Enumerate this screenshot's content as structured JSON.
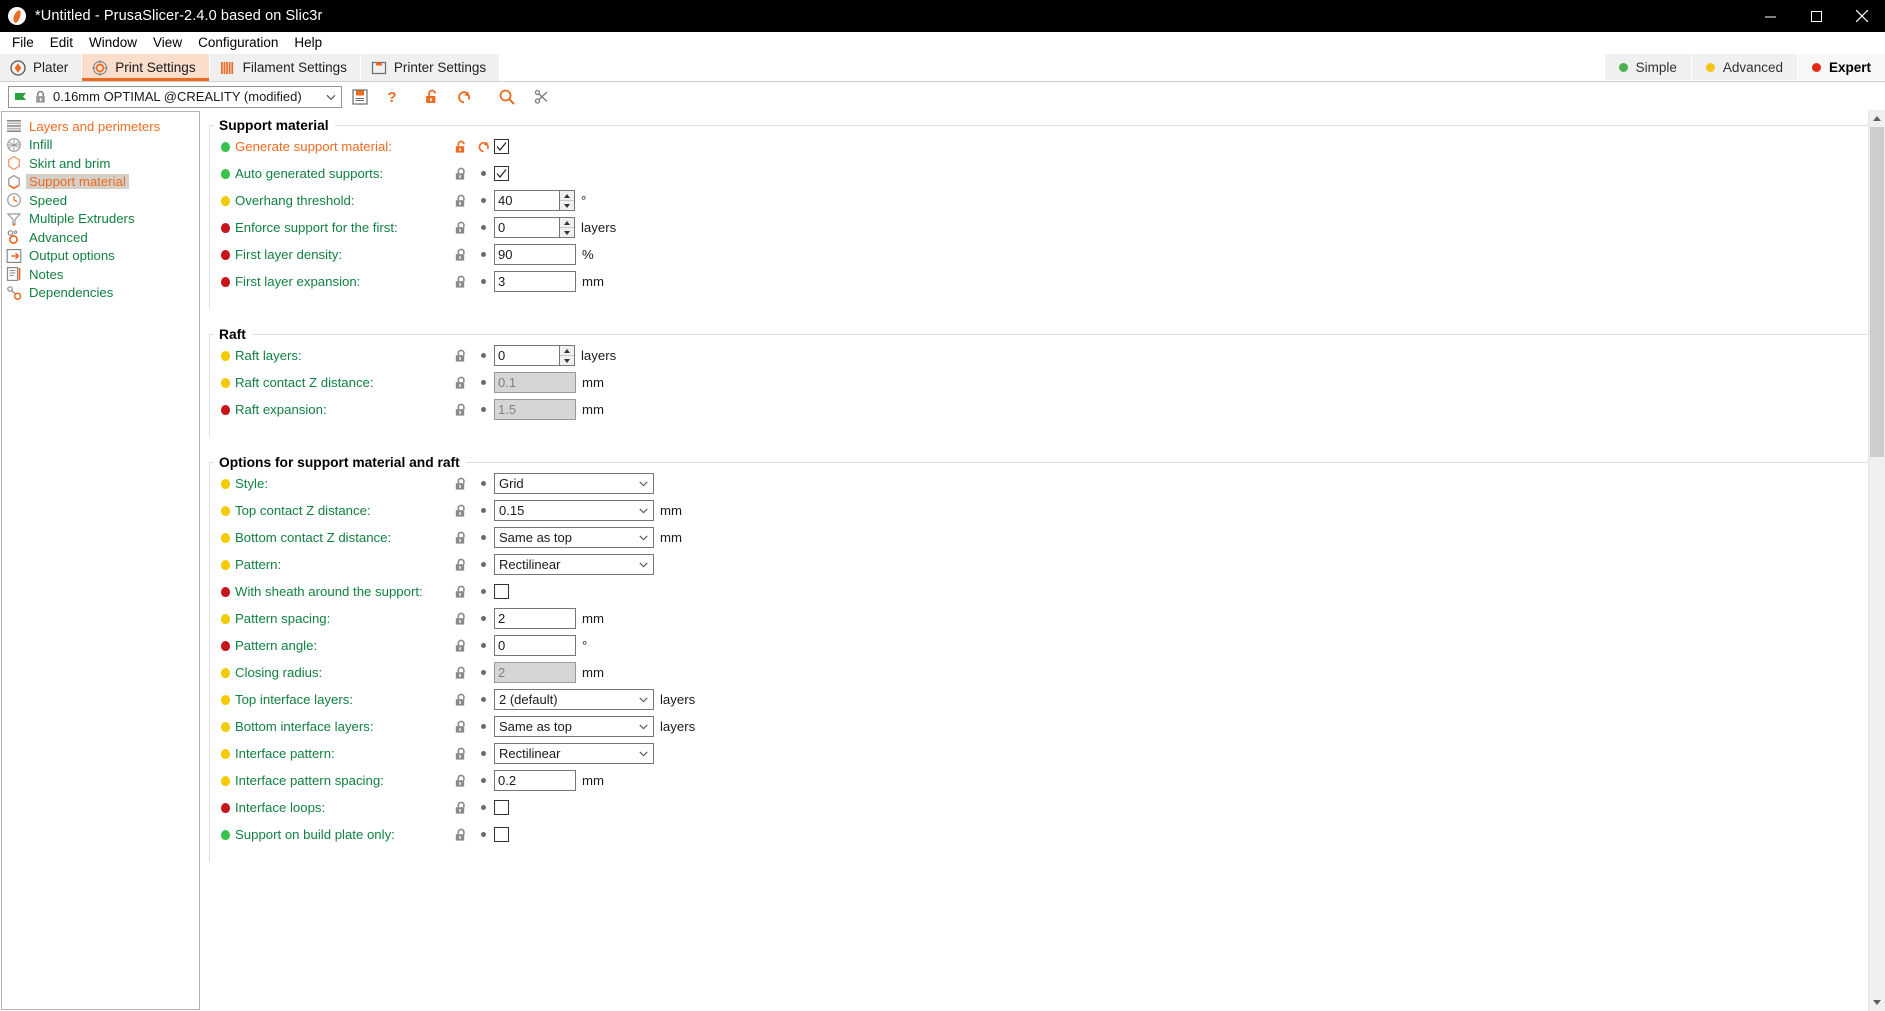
{
  "window": {
    "title": "*Untitled - PrusaSlicer-2.4.0 based on Slic3r",
    "minimize": "minimize",
    "maximize": "maximize",
    "close": "close"
  },
  "menubar": {
    "items": [
      "File",
      "Edit",
      "Window",
      "View",
      "Configuration",
      "Help"
    ]
  },
  "tabs": [
    {
      "label": "Plater",
      "icon": "plater-icon",
      "selected": false
    },
    {
      "label": "Print Settings",
      "icon": "print-settings-icon",
      "selected": true
    },
    {
      "label": "Filament Settings",
      "icon": "filament-settings-icon",
      "selected": false
    },
    {
      "label": "Printer Settings",
      "icon": "printer-settings-icon",
      "selected": false
    }
  ],
  "modes": [
    {
      "label": "Simple",
      "color": "#4caf50",
      "active": false
    },
    {
      "label": "Advanced",
      "color": "#f5c518",
      "active": false
    },
    {
      "label": "Expert",
      "color": "#e32a17",
      "active": true
    }
  ],
  "preset": {
    "value": "0.16mm OPTIMAL @CREALITY (modified)",
    "flag_icon": "green-flag-icon",
    "lock_icon": "lock-closed-icon",
    "chevron": "chevron-down-icon",
    "buttons": [
      {
        "name": "save-preset-button",
        "icon": "floppy-disk-icon"
      },
      {
        "name": "detach-preset-button",
        "icon": "question-mark-icon"
      },
      {
        "name": "lock-all-button",
        "icon": "unlock-orange-icon"
      },
      {
        "name": "revert-all-button",
        "icon": "revert-arrow-icon"
      },
      {
        "name": "search-button",
        "icon": "magnifier-icon"
      },
      {
        "name": "compare-presets-button",
        "icon": "compare-icon"
      }
    ]
  },
  "nav": {
    "items": [
      {
        "label": "Layers and perimeters",
        "icon": "layers-icon",
        "state": "modified",
        "selected": false
      },
      {
        "label": "Infill",
        "icon": "infill-icon",
        "state": "default",
        "selected": false
      },
      {
        "label": "Skirt and brim",
        "icon": "skirt-icon",
        "state": "default",
        "selected": false
      },
      {
        "label": "Support material",
        "icon": "support-icon",
        "state": "modified",
        "selected": true
      },
      {
        "label": "Speed",
        "icon": "speed-icon",
        "state": "default",
        "selected": false
      },
      {
        "label": "Multiple Extruders",
        "icon": "extruders-icon",
        "state": "default",
        "selected": false
      },
      {
        "label": "Advanced",
        "icon": "advanced-icon",
        "state": "default",
        "selected": false
      },
      {
        "label": "Output options",
        "icon": "output-icon",
        "state": "default",
        "selected": false
      },
      {
        "label": "Notes",
        "icon": "notes-icon",
        "state": "default",
        "selected": false
      },
      {
        "label": "Dependencies",
        "icon": "dependencies-icon",
        "state": "default",
        "selected": false
      }
    ]
  },
  "groups": [
    {
      "title": "Support material",
      "rows": [
        {
          "label": "Generate support material:",
          "bullet": "#39c24a",
          "modified": true,
          "lock": "unlock-orange",
          "revert": "revert-orange",
          "control": "checkbox",
          "checked": true,
          "units": ""
        },
        {
          "label": "Auto generated supports:",
          "bullet": "#39c24a",
          "modified": false,
          "lock": "lock-grey",
          "revert": "dot",
          "control": "checkbox",
          "checked": true,
          "units": ""
        },
        {
          "label": "Overhang threshold:",
          "bullet": "#f2cb05",
          "modified": false,
          "lock": "lock-grey",
          "revert": "dot",
          "control": "spinner",
          "value": "40",
          "units": "°"
        },
        {
          "label": "Enforce support for the first:",
          "bullet": "#c6151b",
          "modified": false,
          "lock": "lock-grey",
          "revert": "dot",
          "control": "spinner",
          "value": "0",
          "units": "layers"
        },
        {
          "label": "First layer density:",
          "bullet": "#c6151b",
          "modified": false,
          "lock": "lock-grey",
          "revert": "dot",
          "control": "text",
          "value": "90",
          "units": "%"
        },
        {
          "label": "First layer expansion:",
          "bullet": "#c6151b",
          "modified": false,
          "lock": "lock-grey",
          "revert": "dot",
          "control": "text",
          "value": "3",
          "units": "mm"
        }
      ]
    },
    {
      "title": "Raft",
      "rows": [
        {
          "label": "Raft layers:",
          "bullet": "#f2cb05",
          "modified": false,
          "lock": "lock-grey",
          "revert": "dot",
          "control": "spinner",
          "value": "0",
          "units": "layers"
        },
        {
          "label": "Raft contact Z distance:",
          "bullet": "#f2cb05",
          "modified": false,
          "lock": "lock-grey",
          "revert": "dot",
          "control": "text",
          "value": "0.1",
          "units": "mm",
          "disabled": true
        },
        {
          "label": "Raft expansion:",
          "bullet": "#c6151b",
          "modified": false,
          "lock": "lock-grey",
          "revert": "dot",
          "control": "text",
          "value": "1.5",
          "units": "mm",
          "disabled": true
        }
      ]
    },
    {
      "title": "Options for support material and raft",
      "rows": [
        {
          "label": "Style:",
          "bullet": "#f2cb05",
          "modified": false,
          "lock": "lock-grey",
          "revert": "dot",
          "control": "select",
          "value": "Grid",
          "units": ""
        },
        {
          "label": "Top contact Z distance:",
          "bullet": "#f2cb05",
          "modified": false,
          "lock": "lock-grey",
          "revert": "dot",
          "control": "select",
          "value": "0.15",
          "units": "mm"
        },
        {
          "label": "Bottom contact Z distance:",
          "bullet": "#f2cb05",
          "modified": false,
          "lock": "lock-grey",
          "revert": "dot",
          "control": "select",
          "value": "Same as top",
          "units": "mm"
        },
        {
          "label": "Pattern:",
          "bullet": "#f2cb05",
          "modified": false,
          "lock": "lock-grey",
          "revert": "dot",
          "control": "select",
          "value": "Rectilinear",
          "units": ""
        },
        {
          "label": "With sheath around the support:",
          "bullet": "#c6151b",
          "modified": false,
          "lock": "lock-grey",
          "revert": "dot",
          "control": "checkbox",
          "checked": false,
          "units": ""
        },
        {
          "label": "Pattern spacing:",
          "bullet": "#f2cb05",
          "modified": false,
          "lock": "lock-grey",
          "revert": "dot",
          "control": "text",
          "value": "2",
          "units": "mm"
        },
        {
          "label": "Pattern angle:",
          "bullet": "#c6151b",
          "modified": false,
          "lock": "lock-grey",
          "revert": "dot",
          "control": "text",
          "value": "0",
          "units": "°"
        },
        {
          "label": "Closing radius:",
          "bullet": "#f2cb05",
          "modified": false,
          "lock": "lock-grey",
          "revert": "dot",
          "control": "text",
          "value": "2",
          "units": "mm",
          "disabled": true
        },
        {
          "label": "Top interface layers:",
          "bullet": "#f2cb05",
          "modified": false,
          "lock": "lock-grey",
          "revert": "dot",
          "control": "select",
          "value": "2 (default)",
          "units": "layers"
        },
        {
          "label": "Bottom interface layers:",
          "bullet": "#f2cb05",
          "modified": false,
          "lock": "lock-grey",
          "revert": "dot",
          "control": "select",
          "value": "Same as top",
          "units": "layers"
        },
        {
          "label": "Interface pattern:",
          "bullet": "#f2cb05",
          "modified": false,
          "lock": "lock-grey",
          "revert": "dot",
          "control": "select",
          "value": "Rectilinear",
          "units": ""
        },
        {
          "label": "Interface pattern spacing:",
          "bullet": "#f2cb05",
          "modified": false,
          "lock": "lock-grey",
          "revert": "dot",
          "control": "text",
          "value": "0.2",
          "units": "mm"
        },
        {
          "label": "Interface loops:",
          "bullet": "#c6151b",
          "modified": false,
          "lock": "lock-grey",
          "revert": "dot",
          "control": "checkbox",
          "checked": false,
          "units": ""
        },
        {
          "label": "Support on build plate only:",
          "bullet": "#39c24a",
          "modified": false,
          "lock": "lock-grey",
          "revert": "dot",
          "control": "checkbox",
          "checked": false,
          "units": ""
        }
      ]
    }
  ],
  "scrollbar": {
    "name": "vertical-scrollbar"
  }
}
